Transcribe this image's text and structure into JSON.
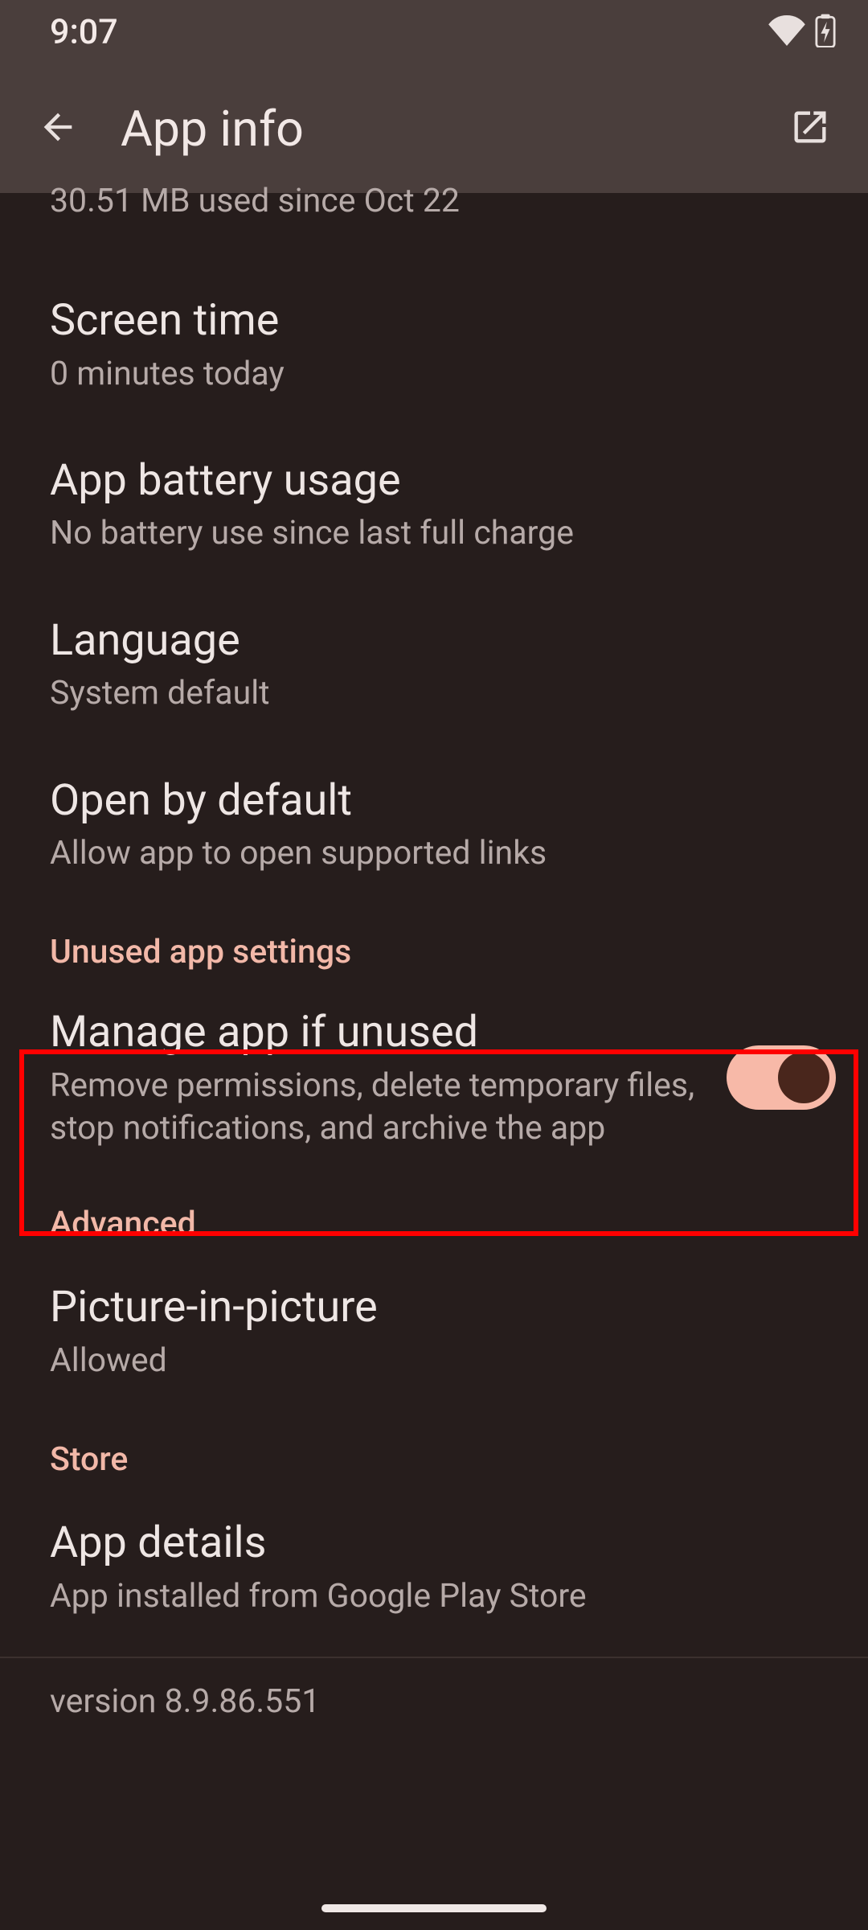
{
  "status": {
    "time": "9:07"
  },
  "header": {
    "title": "App info"
  },
  "partial": {
    "subtitle": "30.51 MB used since Oct 22"
  },
  "rows": {
    "screen_time": {
      "title": "Screen time",
      "subtitle": "0 minutes today"
    },
    "battery": {
      "title": "App battery usage",
      "subtitle": "No battery use since last full charge"
    },
    "language": {
      "title": "Language",
      "subtitle": "System default"
    },
    "open_default": {
      "title": "Open by default",
      "subtitle": "Allow app to open supported links"
    },
    "manage_unused": {
      "title": "Manage app if unused",
      "subtitle": "Remove permissions, delete temporary files, stop notifications, and archive the app",
      "toggle": true
    },
    "pip": {
      "title": "Picture-in-picture",
      "subtitle": "Allowed"
    },
    "app_details": {
      "title": "App details",
      "subtitle": "App installed from Google Play Store"
    }
  },
  "sections": {
    "unused": "Unused app settings",
    "advanced": "Advanced",
    "store": "Store"
  },
  "version": "version 8.9.86.551"
}
